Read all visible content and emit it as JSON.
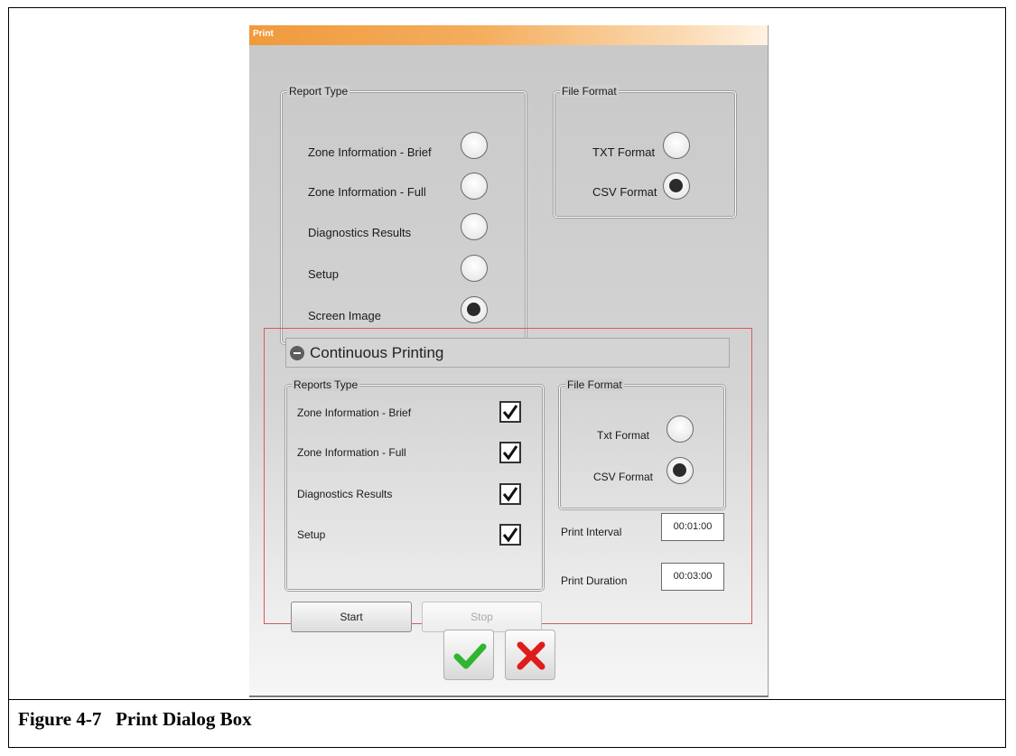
{
  "dialog": {
    "title": "Print"
  },
  "report_type": {
    "title": "Report Type",
    "options": [
      {
        "label": "Zone Information - Brief",
        "selected": false
      },
      {
        "label": "Zone Information - Full",
        "selected": false
      },
      {
        "label": "Diagnostics Results",
        "selected": false
      },
      {
        "label": "Setup",
        "selected": false
      },
      {
        "label": "Screen Image",
        "selected": true
      }
    ]
  },
  "file_format": {
    "title": "File Format",
    "options": [
      {
        "label": "TXT Format",
        "selected": false
      },
      {
        "label": "CSV Format",
        "selected": true
      }
    ]
  },
  "continuous": {
    "title": "Continuous Printing",
    "reports_type": {
      "title": "Reports Type",
      "options": [
        {
          "label": "Zone Information - Brief",
          "checked": true
        },
        {
          "label": "Zone Information - Full",
          "checked": true
        },
        {
          "label": "Diagnostics Results",
          "checked": true
        },
        {
          "label": "Setup",
          "checked": true
        }
      ]
    },
    "file_format": {
      "title": "File Format",
      "options": [
        {
          "label": "Txt Format",
          "selected": false
        },
        {
          "label": "CSV Format",
          "selected": true
        }
      ]
    },
    "print_interval": {
      "label": "Print Interval",
      "value": "00:01:00"
    },
    "print_duration": {
      "label": "Print Duration",
      "value": "00:03:00"
    },
    "start_label": "Start",
    "stop_label": "Stop"
  },
  "icons": {
    "ok": "checkmark-icon",
    "cancel": "x-icon",
    "collapse": "minus-circle-icon"
  },
  "colors": {
    "title_bar": "#f09a3c",
    "section_border": "#d75a5a",
    "ok": "#2fb52f",
    "cancel": "#e01b1b"
  },
  "caption": "Figure 4-7   Print Dialog Box"
}
